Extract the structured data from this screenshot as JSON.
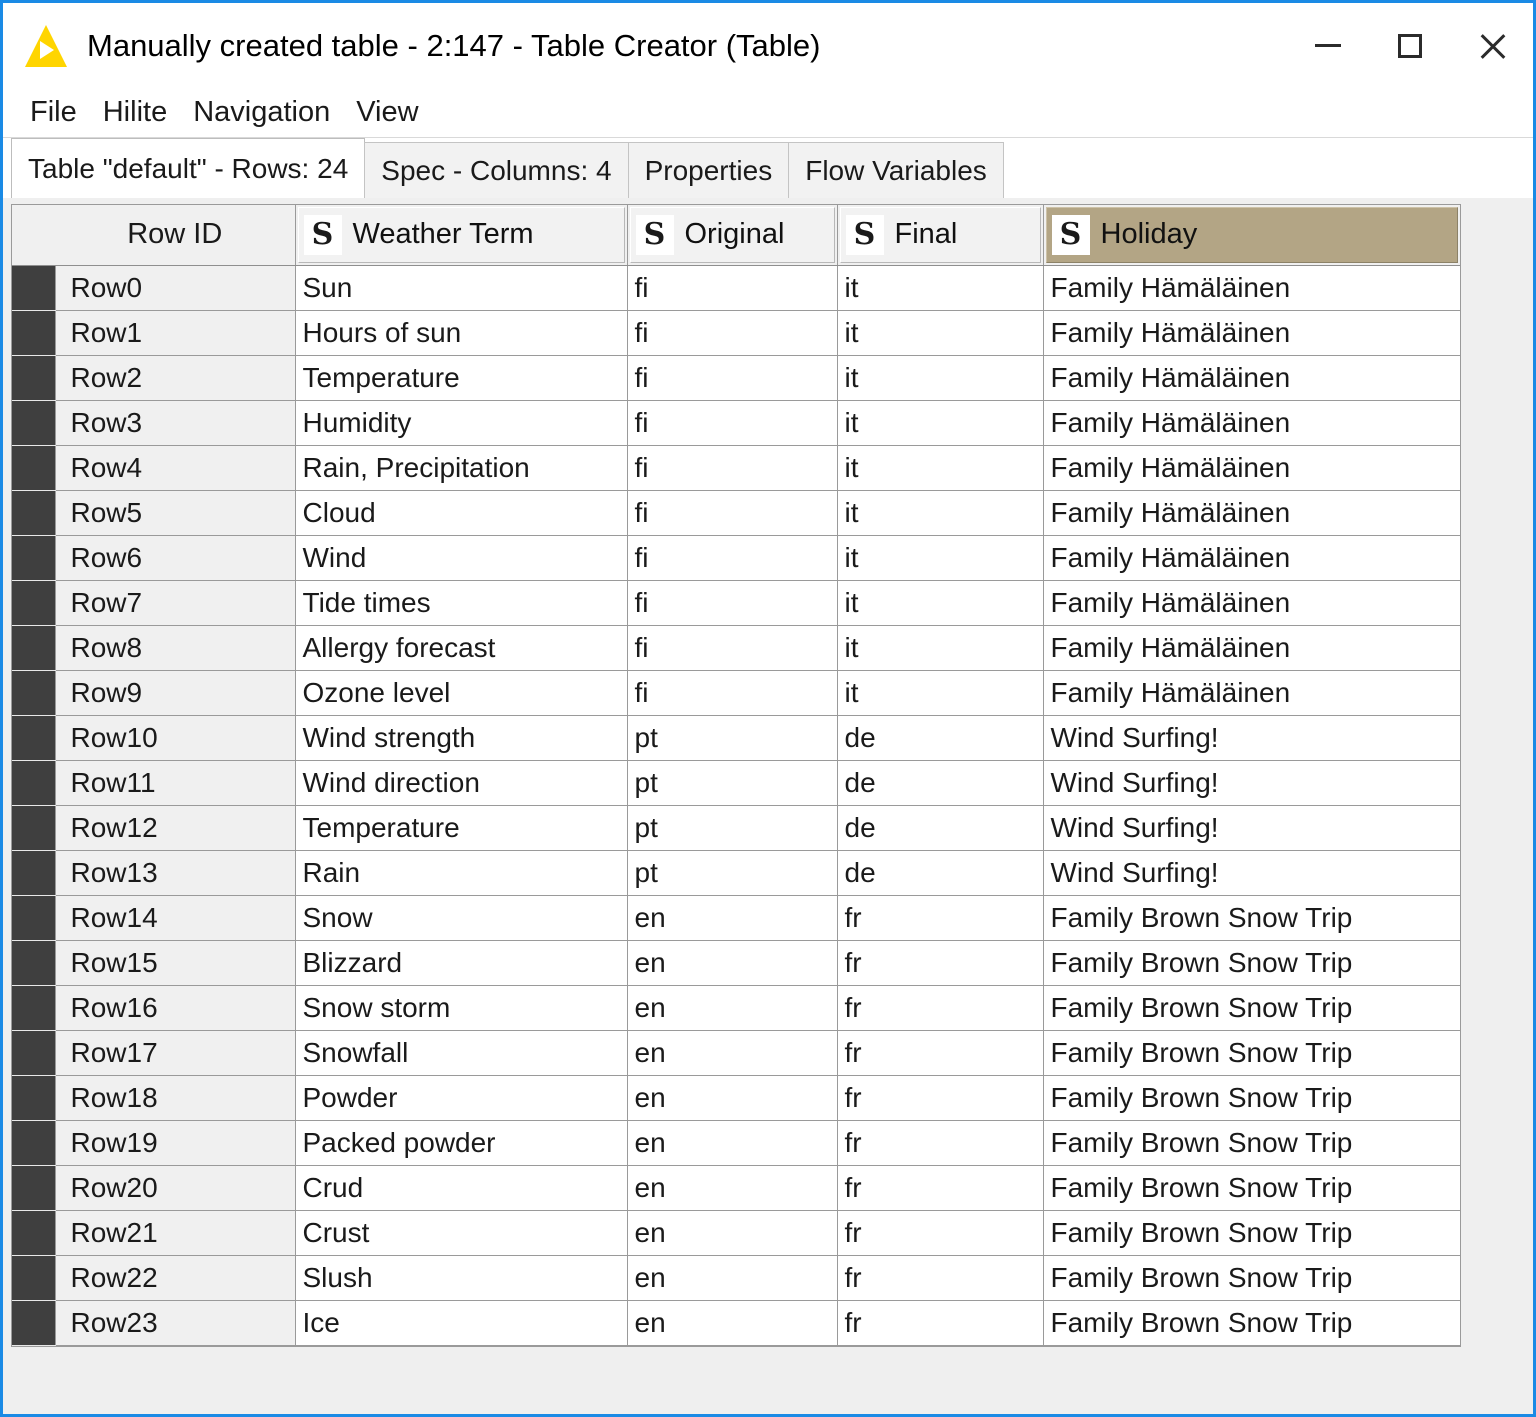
{
  "window": {
    "title": "Manually created table - 2:147 - Table Creator (Table)",
    "logo_icon": "knime-triangle-icon",
    "controls": {
      "minimize": "minimize-icon",
      "maximize": "maximize-icon",
      "close": "close-icon"
    }
  },
  "menubar": {
    "items": [
      {
        "label": "File"
      },
      {
        "label": "Hilite"
      },
      {
        "label": "Navigation"
      },
      {
        "label": "View"
      }
    ]
  },
  "tabs": [
    {
      "label": "Table \"default\" - Rows: 24",
      "active": true
    },
    {
      "label": "Spec - Columns: 4",
      "active": false
    },
    {
      "label": "Properties",
      "active": false
    },
    {
      "label": "Flow Variables",
      "active": false
    }
  ],
  "table": {
    "row_id_header": "Row ID",
    "type_icon_letter": "S",
    "columns": [
      {
        "label": "Weather Term",
        "type_icon": "string-type-icon",
        "selected": false
      },
      {
        "label": "Original",
        "type_icon": "string-type-icon",
        "selected": false
      },
      {
        "label": "Final",
        "type_icon": "string-type-icon",
        "selected": false
      },
      {
        "label": "Holiday",
        "type_icon": "string-type-icon",
        "selected": true
      }
    ],
    "selected_column_color": "#b3a585",
    "row_stripe_color": "#3f3f3f",
    "rows": [
      {
        "row_id": "Row0",
        "weather_term": "Sun",
        "original": "fi",
        "final": "it",
        "holiday": "Family Hämäläinen"
      },
      {
        "row_id": "Row1",
        "weather_term": "Hours of sun",
        "original": "fi",
        "final": "it",
        "holiday": "Family Hämäläinen"
      },
      {
        "row_id": "Row2",
        "weather_term": "Temperature",
        "original": "fi",
        "final": "it",
        "holiday": "Family Hämäläinen"
      },
      {
        "row_id": "Row3",
        "weather_term": "Humidity",
        "original": "fi",
        "final": "it",
        "holiday": "Family Hämäläinen"
      },
      {
        "row_id": "Row4",
        "weather_term": "Rain, Precipitation",
        "original": "fi",
        "final": "it",
        "holiday": "Family Hämäläinen"
      },
      {
        "row_id": "Row5",
        "weather_term": "Cloud",
        "original": "fi",
        "final": "it",
        "holiday": "Family Hämäläinen"
      },
      {
        "row_id": "Row6",
        "weather_term": "Wind",
        "original": "fi",
        "final": "it",
        "holiday": "Family Hämäläinen"
      },
      {
        "row_id": "Row7",
        "weather_term": "Tide times",
        "original": "fi",
        "final": "it",
        "holiday": "Family Hämäläinen"
      },
      {
        "row_id": "Row8",
        "weather_term": "Allergy forecast",
        "original": "fi",
        "final": "it",
        "holiday": "Family Hämäläinen"
      },
      {
        "row_id": "Row9",
        "weather_term": "Ozone level",
        "original": "fi",
        "final": "it",
        "holiday": "Family Hämäläinen"
      },
      {
        "row_id": "Row10",
        "weather_term": "Wind strength",
        "original": "pt",
        "final": "de",
        "holiday": "Wind Surfing!"
      },
      {
        "row_id": "Row11",
        "weather_term": "Wind direction",
        "original": "pt",
        "final": "de",
        "holiday": "Wind Surfing!"
      },
      {
        "row_id": "Row12",
        "weather_term": "Temperature",
        "original": "pt",
        "final": "de",
        "holiday": "Wind Surfing!"
      },
      {
        "row_id": "Row13",
        "weather_term": "Rain",
        "original": "pt",
        "final": "de",
        "holiday": "Wind Surfing!"
      },
      {
        "row_id": "Row14",
        "weather_term": "Snow",
        "original": "en",
        "final": "fr",
        "holiday": "Family Brown Snow Trip"
      },
      {
        "row_id": "Row15",
        "weather_term": "Blizzard",
        "original": "en",
        "final": "fr",
        "holiday": "Family Brown Snow Trip"
      },
      {
        "row_id": "Row16",
        "weather_term": "Snow storm",
        "original": "en",
        "final": "fr",
        "holiday": "Family Brown Snow Trip"
      },
      {
        "row_id": "Row17",
        "weather_term": "Snowfall",
        "original": "en",
        "final": "fr",
        "holiday": "Family Brown Snow Trip"
      },
      {
        "row_id": "Row18",
        "weather_term": "Powder",
        "original": "en",
        "final": "fr",
        "holiday": "Family Brown Snow Trip"
      },
      {
        "row_id": "Row19",
        "weather_term": "Packed powder",
        "original": "en",
        "final": "fr",
        "holiday": "Family Brown Snow Trip"
      },
      {
        "row_id": "Row20",
        "weather_term": "Crud",
        "original": "en",
        "final": "fr",
        "holiday": "Family Brown Snow Trip"
      },
      {
        "row_id": "Row21",
        "weather_term": "Crust",
        "original": "en",
        "final": "fr",
        "holiday": "Family Brown Snow Trip"
      },
      {
        "row_id": "Row22",
        "weather_term": "Slush",
        "original": "en",
        "final": "fr",
        "holiday": "Family Brown Snow Trip"
      },
      {
        "row_id": "Row23",
        "weather_term": "Ice",
        "original": "en",
        "final": "fr",
        "holiday": "Family Brown Snow Trip"
      }
    ]
  }
}
